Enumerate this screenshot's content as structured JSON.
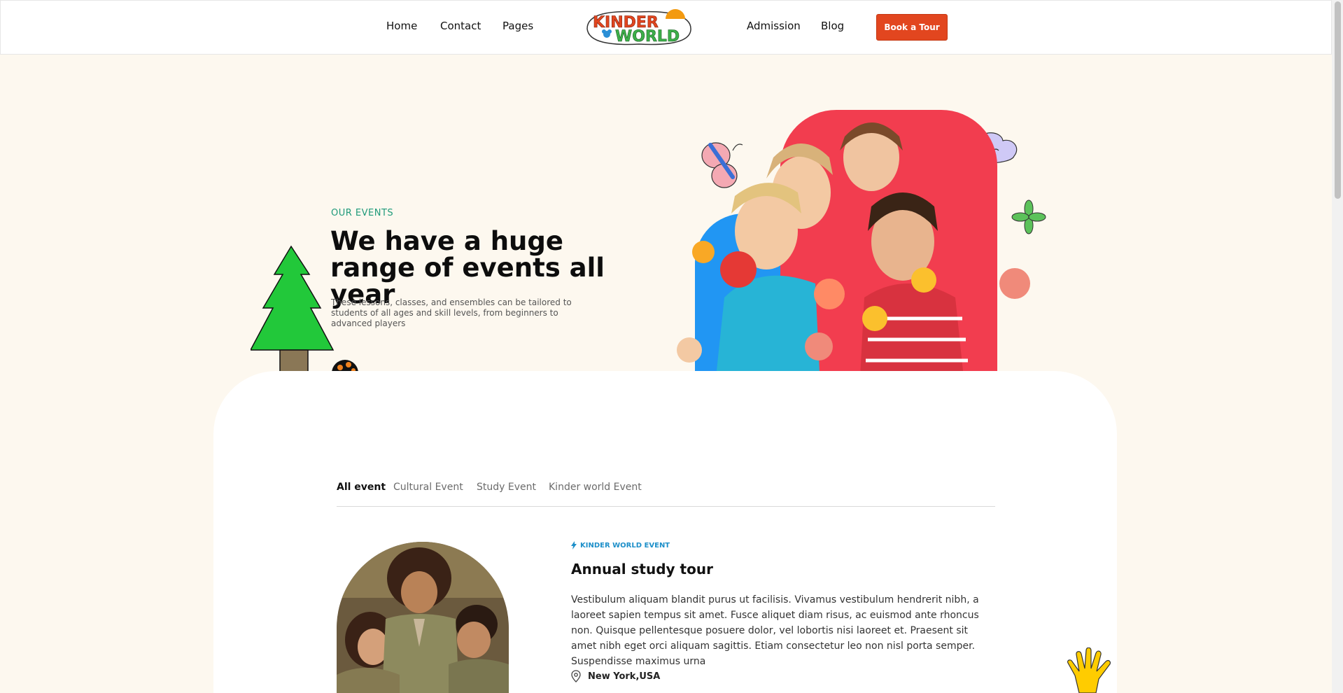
{
  "nav": {
    "left": [
      "Home",
      "Contact",
      "Pages"
    ],
    "right": [
      "Admission",
      "Blog"
    ],
    "logo_top": "KINDER",
    "logo_bottom": "WORLD",
    "cta": "Book a Tour"
  },
  "hero": {
    "eyebrow": "OUR EVENTS",
    "title": "We have a huge range of events all year",
    "description": "These lessons, classes, and ensembles can be tailored to students of all ages and skill levels, from beginners to advanced players"
  },
  "tabs": [
    "All event",
    "Cultural Event",
    "Study Event",
    "Kinder world Event"
  ],
  "active_tab": "All event",
  "event": {
    "tag": "KINDER WORLD EVENT",
    "title": "Annual study tour",
    "description": "Vestibulum aliquam blandit purus ut facilisis. Vivamus vestibulum hendrerit nibh, a laoreet sapien tempus sit amet. Fusce aliquet diam risus, ac euismod ante rhoncus non. Quisque pellentesque posuere dolor, vel lobortis nisi laoreet et. Praesent sit amet nibh eget orci aliquam sagittis. Etiam consectetur leo non nisl porta semper. Suspendisse maximus urna",
    "location": "New York,USA"
  },
  "colors": {
    "accent": "#e2461f",
    "teal": "#1f9a7a",
    "blue": "#1d8fc9",
    "background": "#fdf8ef"
  }
}
